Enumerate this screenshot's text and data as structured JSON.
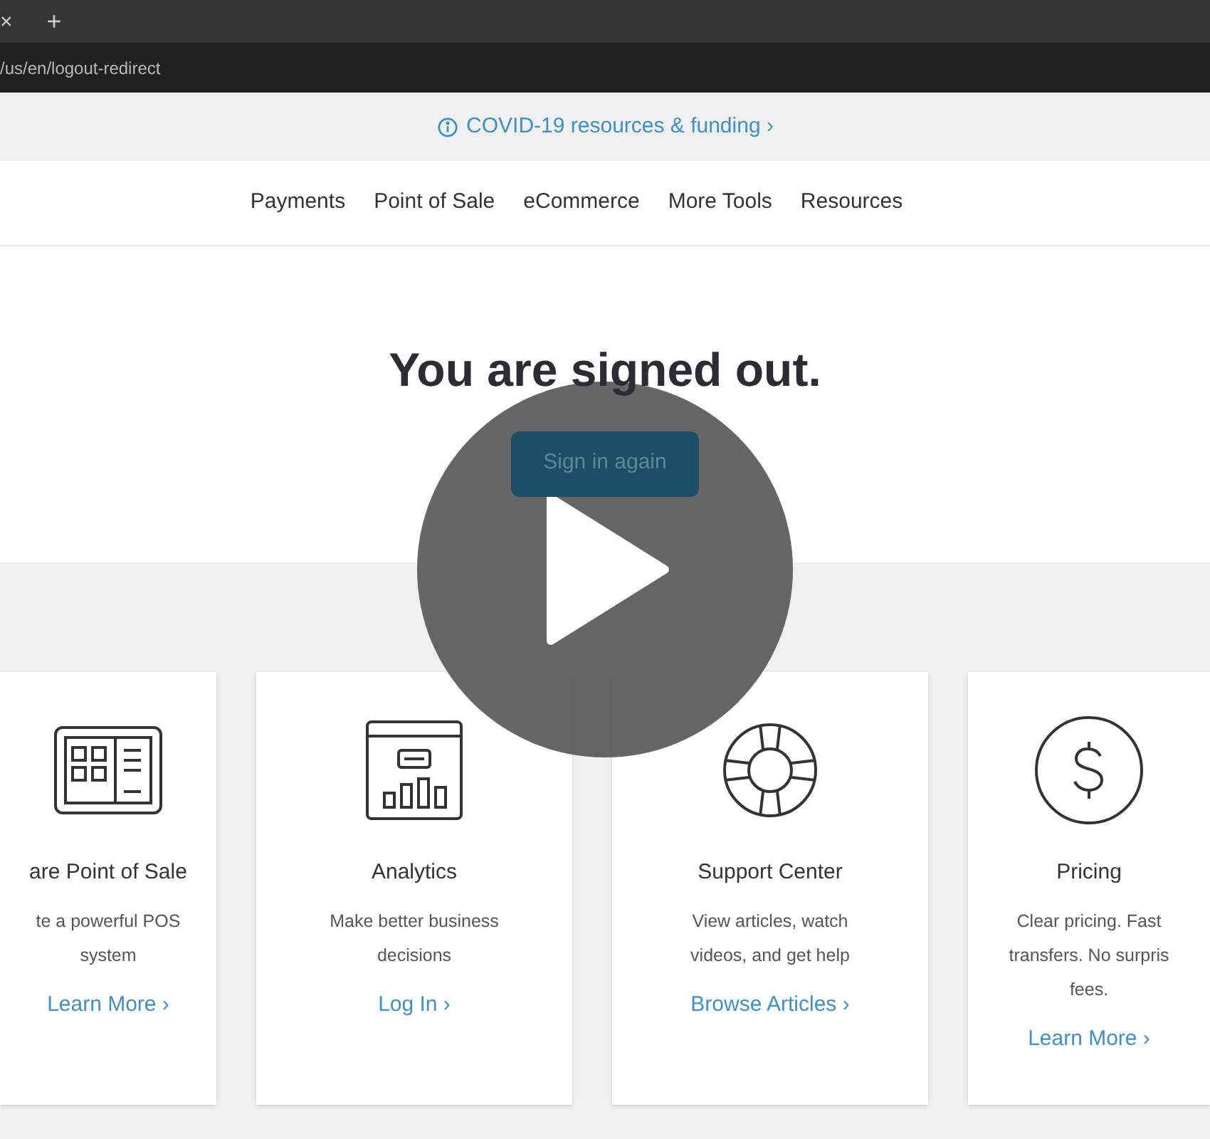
{
  "browser": {
    "tab_close": "×",
    "new_tab": "+",
    "url": "/us/en/logout-redirect"
  },
  "banner": {
    "text": "COVID-19 resources & funding ›"
  },
  "nav": [
    "Payments",
    "Point of Sale",
    "eCommerce",
    "More Tools",
    "Resources"
  ],
  "hero": {
    "title": "You are signed out.",
    "button": "Sign in again"
  },
  "cards": [
    {
      "kind": "pos",
      "title": "are Point of Sale",
      "lines": [
        "te a powerful POS",
        "system"
      ],
      "link": "Learn More ›"
    },
    {
      "kind": "analytics",
      "title": "Analytics",
      "lines": [
        "Make better business",
        "decisions"
      ],
      "link": "Log In ›"
    },
    {
      "kind": "support",
      "title": "Support Center",
      "lines": [
        "View articles, watch",
        "videos, and get help"
      ],
      "link": "Browse Articles ›"
    },
    {
      "kind": "pricing",
      "title": "Pricing",
      "lines": [
        "Clear pricing. Fast",
        "transfers. No surpris",
        "fees."
      ],
      "link": "Learn More ›"
    }
  ]
}
